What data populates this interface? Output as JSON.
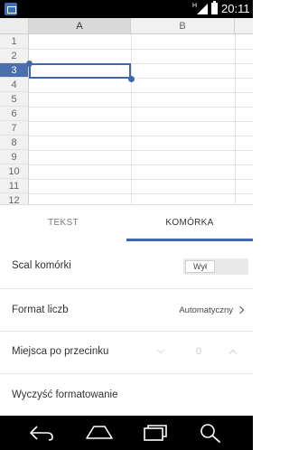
{
  "status_bar": {
    "network_label": "H",
    "time": "20:11"
  },
  "sheet": {
    "columns": [
      "A",
      "B"
    ],
    "rows": [
      "1",
      "2",
      "3",
      "4",
      "5",
      "6",
      "7",
      "8",
      "9",
      "10",
      "11",
      "12"
    ],
    "selected_column": "A",
    "selected_row": "3"
  },
  "tabs": {
    "text_tab": "TEKST",
    "cell_tab": "KOMÓRKA",
    "active": "KOMÓRKA"
  },
  "options": {
    "merge_cells": {
      "label": "Scal komórki",
      "toggle_label": "Wył"
    },
    "number_format": {
      "label": "Format liczb",
      "value": "Automatyczny"
    },
    "decimal_places": {
      "label": "Miejsca po przecinku",
      "value": "0"
    },
    "clear_formatting": {
      "label": "Wyczyść formatowanie"
    }
  },
  "colors": {
    "accent": "#3f67b0",
    "status_bar": "#000000",
    "nav_bar": "#000000"
  },
  "icons": {
    "nav_back": "back-icon",
    "nav_home": "home-icon",
    "nav_recents": "recents-icon",
    "search": "search-icon"
  }
}
